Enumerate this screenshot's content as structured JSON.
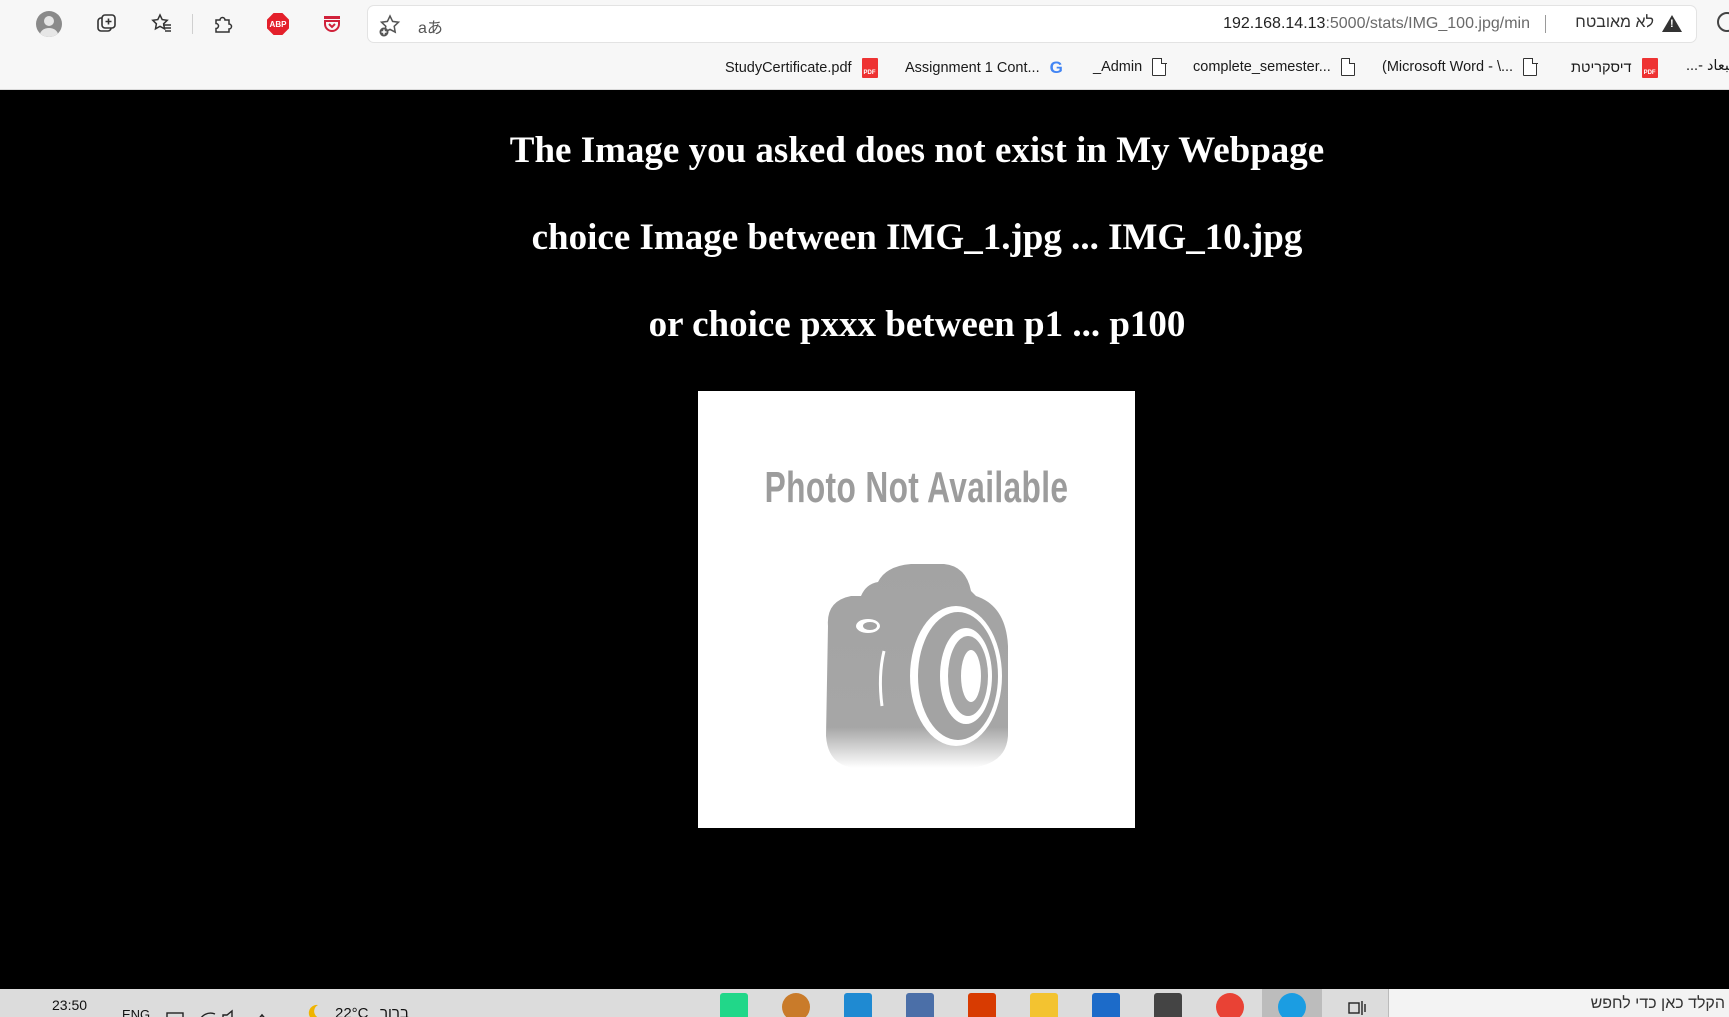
{
  "browser": {
    "address": {
      "host": "192.168.14.13",
      "path": ":5000/stats/IMG_100.jpg/min",
      "security_label": "לא מאובטח",
      "read_aloud_icon": "aあ"
    },
    "icons": {
      "abp_label": "ABP"
    }
  },
  "bookmarks": [
    {
      "label": "StudyCertificate.pdf",
      "icon": "pdf-icon"
    },
    {
      "label": "Assignment 1 Cont...",
      "icon": "google-icon"
    },
    {
      "label": "_Admin",
      "icon": "document-icon"
    },
    {
      "label": "complete_semester...",
      "icon": "document-icon"
    },
    {
      "label": "(Microsoft Word - \\...",
      "icon": "document-icon"
    },
    {
      "label": "דיסקריטת",
      "icon": "pdf-icon"
    },
    {
      "label": "...- ةيبعاد",
      "icon": "none"
    }
  ],
  "page": {
    "line1": "The Image you asked does not exist in My Webpage",
    "line2": "choice Image between IMG_1.jpg ... IMG_10.jpg",
    "line3": "or choice pxxx between p1 ... p100",
    "placeholder_text": "Photo Not Available"
  },
  "taskbar": {
    "time": "23:50",
    "language": "ENG",
    "weather": "22°C",
    "weather_text": "ברור",
    "search_placeholder": "הקלד כאן כדי לחפש"
  }
}
